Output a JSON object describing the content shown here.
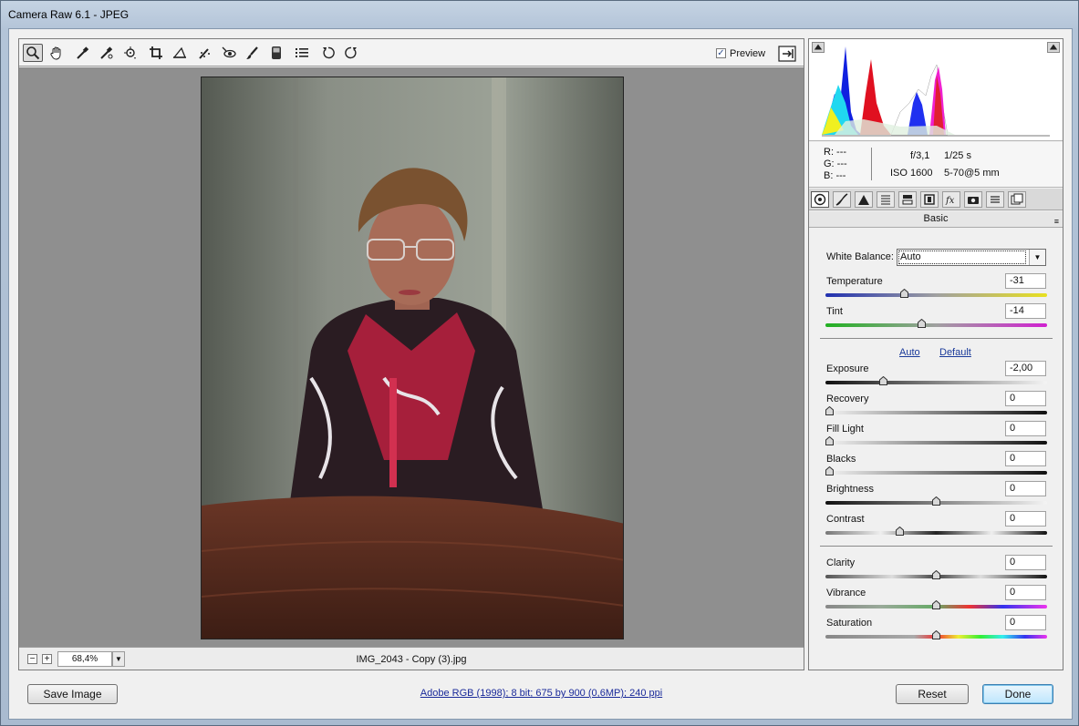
{
  "window": {
    "title": "Camera Raw 6.1  -  JPEG"
  },
  "toolbar": {
    "tools": [
      "zoom-icon",
      "hand-icon",
      "white-balance-icon",
      "color-sampler-icon",
      "target-adjust-icon",
      "crop-icon",
      "straighten-icon",
      "spot-removal-icon",
      "red-eye-icon",
      "adjustment-brush-icon",
      "graduated-filter-icon",
      "preferences-icon",
      "rotate-left-icon",
      "rotate-right-icon"
    ],
    "preview_label": "Preview",
    "preview_checked": true
  },
  "status": {
    "zoom_minus": "−",
    "zoom_plus": "+",
    "zoom_value": "68,4%",
    "filename": "IMG_2043 - Copy (3).jpg"
  },
  "readout": {
    "r": "R:  ---",
    "g": "G:  ---",
    "b": "B:  ---",
    "aperture": "f/3,1",
    "shutter": "1/25 s",
    "iso": "ISO 1600",
    "lens": "5-70@5 mm"
  },
  "panel": {
    "title": "Basic",
    "menu_icon": "≡",
    "white_balance_label": "White Balance:",
    "white_balance_value": "Auto",
    "auto_link": "Auto",
    "default_link": "Default",
    "sliders": {
      "temperature": {
        "label": "Temperature",
        "value": "-31",
        "level": 0.35
      },
      "tint": {
        "label": "Tint",
        "value": "-14",
        "level": 0.43
      },
      "exposure": {
        "label": "Exposure",
        "value": "-2,00",
        "level": 0.25
      },
      "recovery": {
        "label": "Recovery",
        "value": "0",
        "level": 0.0
      },
      "fill_light": {
        "label": "Fill Light",
        "value": "0",
        "level": 0.0
      },
      "blacks": {
        "label": "Blacks",
        "value": "0",
        "level": 0.0
      },
      "brightness": {
        "label": "Brightness",
        "value": "0",
        "level": 0.5
      },
      "contrast": {
        "label": "Contrast",
        "value": "0",
        "level": 0.33
      },
      "clarity": {
        "label": "Clarity",
        "value": "0",
        "level": 0.5
      },
      "vibrance": {
        "label": "Vibrance",
        "value": "0",
        "level": 0.5
      },
      "saturation": {
        "label": "Saturation",
        "value": "0",
        "level": 0.5
      }
    }
  },
  "footer": {
    "save_label": "Save Image",
    "info": "Adobe RGB (1998); 8 bit; 675 by 900 (0,6MP); 240 ppi",
    "reset_label": "Reset",
    "done_label": "Done"
  },
  "colors": {
    "link": "#1a3a9a",
    "canvas": "#8f8f8f",
    "shirt": "#b4203e"
  }
}
